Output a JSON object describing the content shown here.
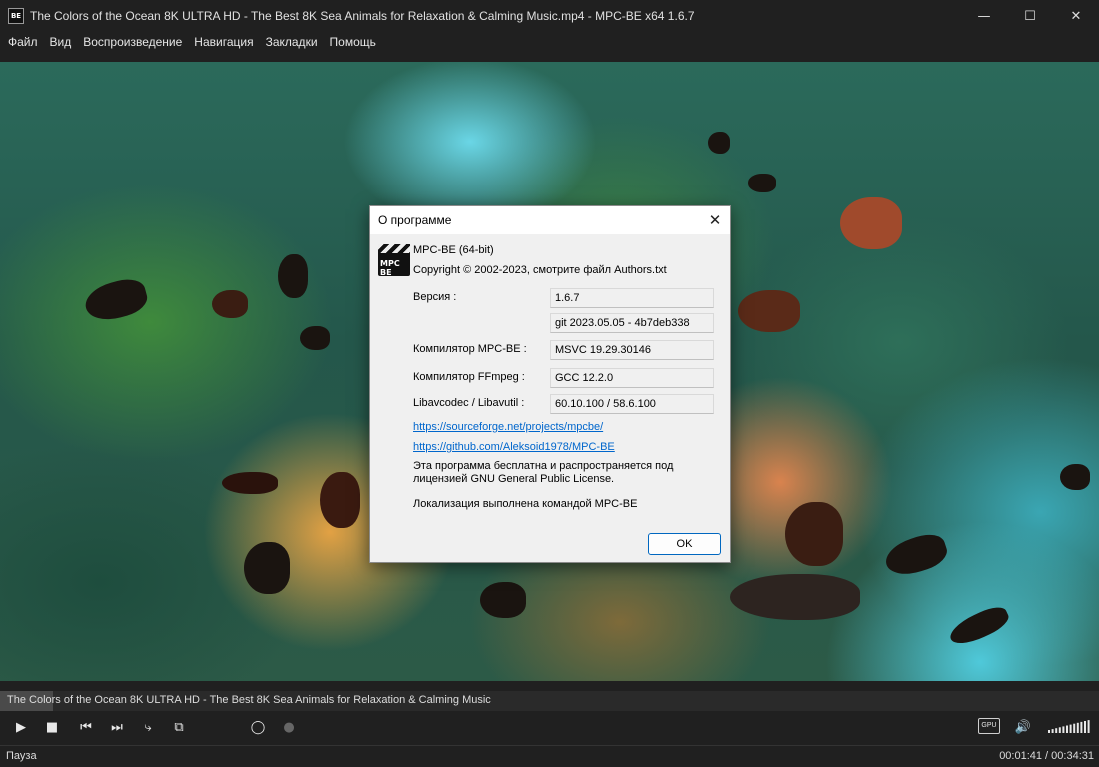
{
  "window": {
    "title": "The Colors of the Ocean 8K ULTRA HD - The Best 8K Sea Animals for Relaxation & Calming Music.mp4 - MPC-BE x64 1.6.7",
    "app_icon_text": "BE",
    "minimize": "—",
    "maximize": "☐",
    "close": "✕"
  },
  "menu": {
    "items": [
      "Файл",
      "Вид",
      "Воспроизведение",
      "Навигация",
      "Закладки",
      "Помощь"
    ]
  },
  "dialog": {
    "title": "О программе",
    "close": "✕",
    "logo_text": "MPC BE",
    "product": "MPC-BE (64-bit)",
    "copyright": "Copyright © 2002-2023, смотрите файл Authors.txt",
    "rows": [
      {
        "label": "Версия :",
        "value": "1.6.7"
      },
      {
        "label": "",
        "value": "git 2023.05.05 - 4b7deb338"
      },
      {
        "label": "Компилятор MPC-BE :",
        "value": "MSVC 19.29.30146"
      },
      {
        "label": "Компилятор FFmpeg :",
        "value": "GCC 12.2.0"
      },
      {
        "label": "Libavcodec / Libavutil :",
        "value": "60.10.100 / 58.6.100"
      }
    ],
    "links": [
      "https://sourceforge.net/projects/mpcbe/",
      "https://github.com/Aleksoid1978/MPC-BE"
    ],
    "license_line1": "Эта программа бесплатна и распространяется под",
    "license_line2": "лицензией GNU General Public License.",
    "localization": "Локализация выполнена командой MPC-BE",
    "ok": "OK"
  },
  "seek": {
    "text": "The Colors of the Ocean 8K ULTRA HD - The Best 8K Sea Animals for Relaxation & Calming Music",
    "progress_fraction": 0.048
  },
  "controls": {
    "play": "▶",
    "stop": "■",
    "prev": "⏮",
    "next": "⏭",
    "frame": "⤷",
    "fullscreen": "⧉",
    "search": "◯",
    "record": "●",
    "gpu": "GPU",
    "speaker": "🔊",
    "volume_fraction": 1.0
  },
  "status": {
    "state": "Пауза",
    "time": "00:01:41 / 00:34:31"
  }
}
